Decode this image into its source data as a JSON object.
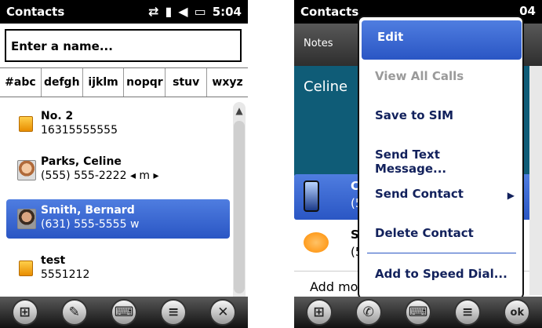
{
  "left": {
    "status": {
      "title": "Contacts",
      "time": "5:04"
    },
    "search": {
      "placeholder": "Enter a name..."
    },
    "groups": [
      "#abc",
      "defgh",
      "ijklm",
      "nopqr",
      "stuv",
      "wxyz"
    ],
    "contacts": [
      {
        "name": "No. 2",
        "detail": "16315555555",
        "thumb": "sim-card-icon"
      },
      {
        "name": "Parks, Celine",
        "detail": "(555) 555-2222   ◂ m ▸",
        "thumb": "avatar-celine"
      },
      {
        "name": "Smith, Bernard",
        "detail": "(631) 555-5555  w",
        "thumb": "avatar-bernard"
      },
      {
        "name": "test",
        "detail": "5551212",
        "thumb": "sim-card-icon"
      }
    ],
    "bottom": [
      "start-icon",
      "new-contact-icon",
      "keyboard-icon",
      "menu-icon",
      "close-icon"
    ]
  },
  "right": {
    "status": {
      "title": "Contacts",
      "time": "04"
    },
    "notes_tab": "Notes",
    "contact_name": "Celine",
    "call_row": {
      "label": "C",
      "sub": "(5"
    },
    "sms_row": {
      "label": "S",
      "sub": "(5"
    },
    "add_more": "Add more numbers",
    "menu": [
      {
        "label": "Edit",
        "state": "selected"
      },
      {
        "label": "View All Calls",
        "state": "disabled"
      },
      {
        "label": "Save to SIM",
        "state": "normal"
      },
      {
        "label": "Send Text Message...",
        "state": "normal"
      },
      {
        "label": "Send Contact",
        "state": "normal",
        "submenu": true
      },
      {
        "label": "Delete Contact",
        "state": "normal"
      },
      {
        "label": "Add to Speed Dial...",
        "state": "normal"
      }
    ],
    "bottom": [
      "start-icon",
      "phone-icon",
      "keyboard-icon",
      "menu-icon",
      "ok-button"
    ],
    "ok_label": "ok"
  },
  "colors": {
    "selection": "#2a56c4",
    "header": "#0f5c77"
  }
}
